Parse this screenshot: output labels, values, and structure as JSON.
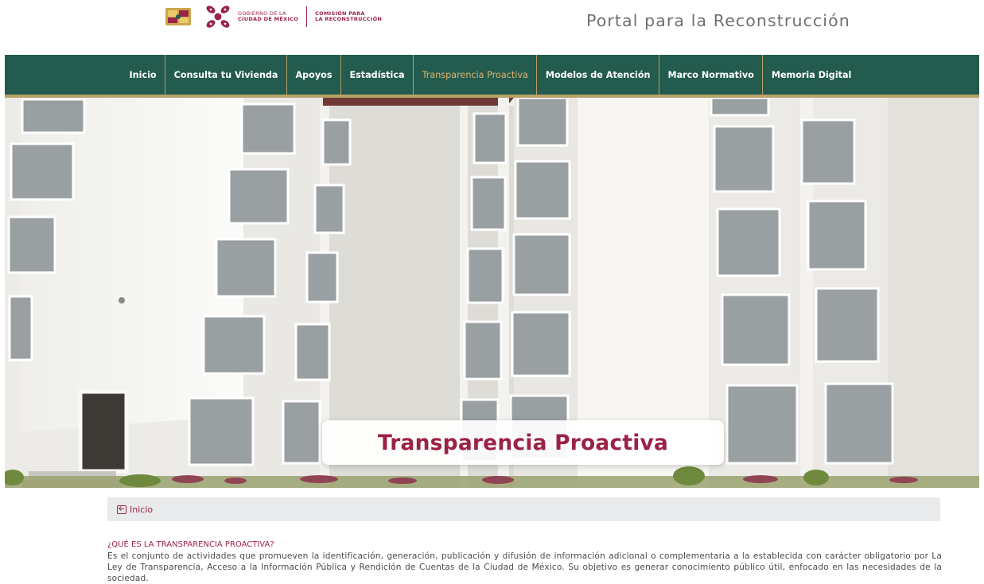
{
  "header": {
    "gov_logo_line1": "GOBIERNO DE LA",
    "gov_logo_line2": "CIUDAD DE MÉXICO",
    "commission_line1": "COMISIÓN PARA",
    "commission_line2": "LA RECONSTRUCCIÓN",
    "portal_title": "Portal para la Reconstrucción"
  },
  "nav": {
    "items": [
      {
        "label": "Inicio"
      },
      {
        "label": "Consulta tu Vivienda"
      },
      {
        "label": "Apoyos"
      },
      {
        "label": "Estadística"
      },
      {
        "label": "Transparencia Proactiva"
      },
      {
        "label": "Modelos de Atención"
      },
      {
        "label": "Marco Normativo"
      },
      {
        "label": "Memoria Digital"
      }
    ],
    "active": "Transparencia Proactiva"
  },
  "hero": {
    "title": "Transparencia Proactiva",
    "image": "white multi-storey residential buildings"
  },
  "breadcrumb": {
    "icon": "back-arrow-icon",
    "link": "Inicio"
  },
  "content": {
    "heading": "¿QUÉ ES LA TRANSPARENCIA PROACTIVA?",
    "body": "Es el conjunto de actividades que promueven la identificación, generación, publicación y difusión de información adicional o complementaria a la establecida con carácter obligatorio por La Ley de Transparencia, Acceso a la Información Pública y Rendición de Cuentas de la Ciudad de México. Su objetivo es generar conocimiento público útil, enfocado en las necesidades de la sociedad."
  },
  "colors": {
    "nav_bg": "#235b4e",
    "gold": "#b8a069",
    "active_nav": "#e1b26f",
    "brand": "#9b2247"
  }
}
